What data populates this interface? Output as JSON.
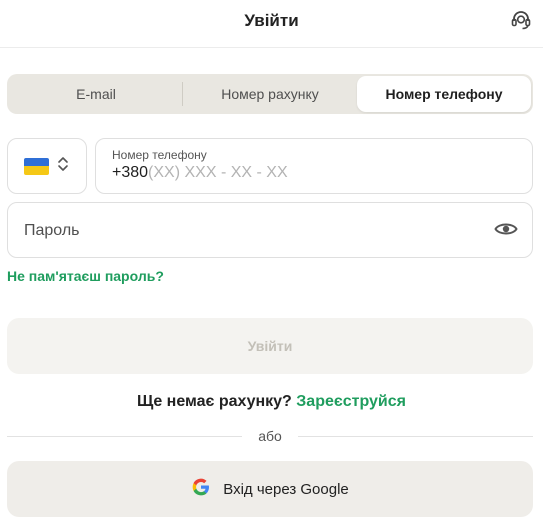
{
  "header": {
    "title": "Увійти",
    "support_icon": "headset-support-icon"
  },
  "tabs": [
    {
      "label": "E-mail",
      "active": false
    },
    {
      "label": "Номер рахунку",
      "active": false
    },
    {
      "label": "Номер телефону",
      "active": true
    }
  ],
  "phone": {
    "country_flag": "ukraine-flag-icon",
    "label": "Номер телефону",
    "prefix": "+380",
    "placeholder": "(XX) XXX - XX - XX",
    "value": ""
  },
  "password": {
    "placeholder": "Пароль",
    "value": "",
    "toggle_icon": "eye-icon"
  },
  "forgot_link": "Не пам'ятаєш пароль?",
  "submit_label": "Увійти",
  "register": {
    "question": "Ще немає рахунку? ",
    "link": "Зареєструйся"
  },
  "divider_label": "або",
  "google": {
    "label": "Вхід через Google",
    "icon": "google-logo-icon"
  },
  "colors": {
    "accent_green": "#1f9d5e",
    "tabs_bg": "#e9e7e1",
    "submit_bg": "#f4f3f0",
    "submit_text": "#c3c0b8",
    "google_bg": "#efede9"
  }
}
